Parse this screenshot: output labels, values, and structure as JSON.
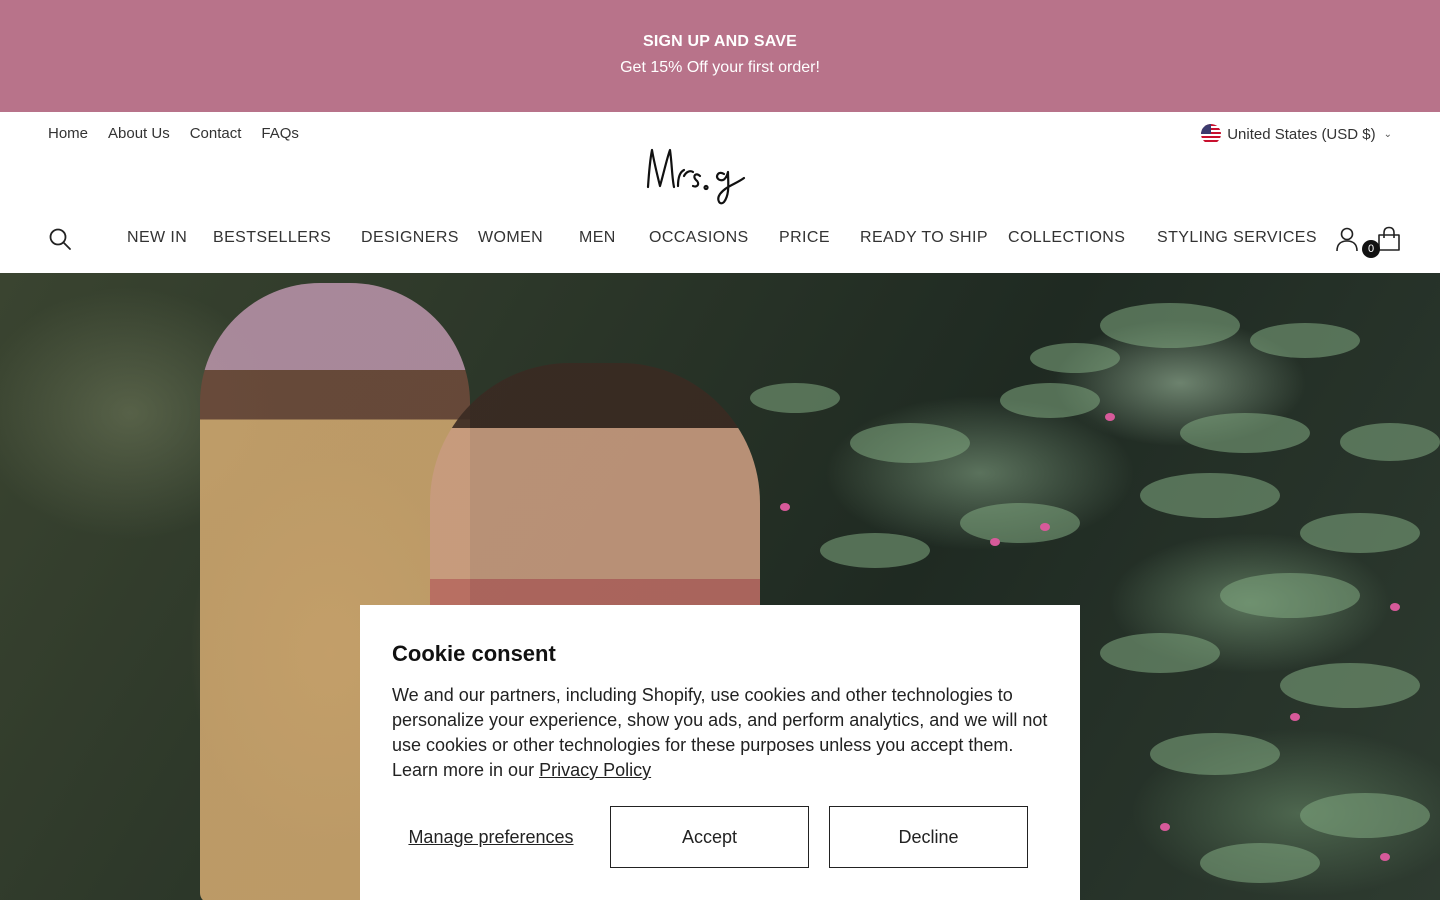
{
  "announcement": {
    "title": "SIGN UP AND SAVE",
    "subtitle": "Get 15% Off your first order!",
    "background": "#b8738a"
  },
  "header": {
    "top_links": [
      "Home",
      "About Us",
      "Contact",
      "FAQs"
    ],
    "country_selector": "United States (USD $)",
    "logo_text": "Mrs. g",
    "nav": [
      "NEW IN",
      "BESTSELLERS",
      "DESIGNERS",
      "WOMEN",
      "MEN",
      "OCCASIONS",
      "PRICE",
      "READY TO SHIP",
      "COLLECTIONS",
      "STYLING SERVICES"
    ],
    "cart_count": "0",
    "icons": [
      "search-icon",
      "account-icon",
      "cart-icon",
      "us-flag-icon",
      "chevron-down-icon"
    ]
  },
  "cookie": {
    "title": "Cookie consent",
    "body": "We and our partners, including Shopify, use cookies and other technologies to personalize your experience, show you ads, and perform analytics, and we will not use cookies or other technologies for these purposes unless you accept them. Learn more in our ",
    "privacy_link": "Privacy Policy",
    "manage_label": "Manage preferences",
    "accept_label": "Accept",
    "decline_label": "Decline"
  }
}
